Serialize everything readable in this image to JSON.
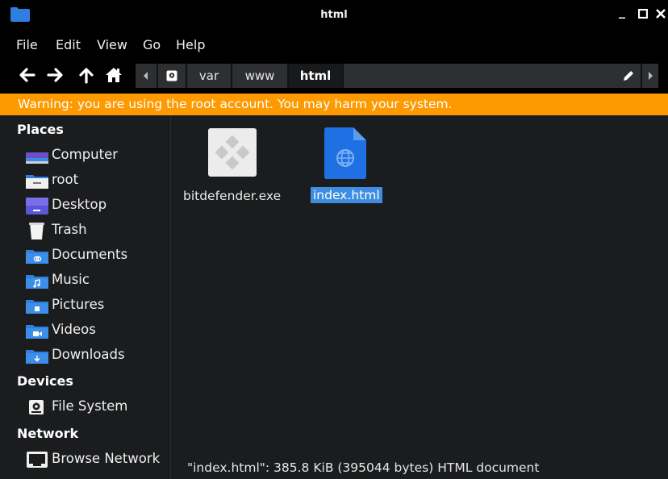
{
  "window": {
    "title": "html"
  },
  "menu": {
    "file": "File",
    "edit": "Edit",
    "view": "View",
    "go": "Go",
    "help": "Help"
  },
  "path": {
    "crumbs": [
      "var",
      "www",
      "html"
    ]
  },
  "warning": "Warning: you are using the root account. You may harm your system.",
  "sidebar": {
    "places_header": "Places",
    "places": [
      {
        "label": "Computer",
        "icon": "computer-icon"
      },
      {
        "label": "root",
        "icon": "home-folder-icon"
      },
      {
        "label": "Desktop",
        "icon": "desktop-folder-icon"
      },
      {
        "label": "Trash",
        "icon": "trash-icon"
      },
      {
        "label": "Documents",
        "icon": "documents-folder-icon"
      },
      {
        "label": "Music",
        "icon": "music-folder-icon"
      },
      {
        "label": "Pictures",
        "icon": "pictures-folder-icon"
      },
      {
        "label": "Videos",
        "icon": "videos-folder-icon"
      },
      {
        "label": "Downloads",
        "icon": "downloads-folder-icon"
      }
    ],
    "devices_header": "Devices",
    "devices": [
      {
        "label": "File System",
        "icon": "drive-icon"
      }
    ],
    "network_header": "Network",
    "network": [
      {
        "label": "Browse Network",
        "icon": "network-icon"
      }
    ]
  },
  "files": [
    {
      "name": "bitdefender.exe",
      "icon": "executable-icon",
      "selected": false
    },
    {
      "name": "index.html",
      "icon": "html-file-icon",
      "selected": true
    }
  ],
  "status": "\"index.html\": 385.8 KiB (395044 bytes) HTML document",
  "colors": {
    "accent": "#3d8ee1",
    "warning": "#fd9a01",
    "folder": "#2f7fe0"
  }
}
